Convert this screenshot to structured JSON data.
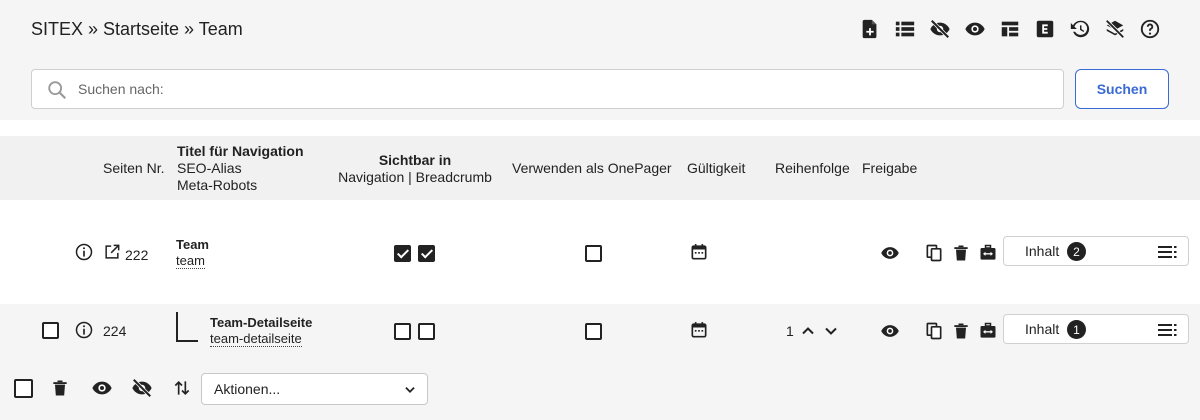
{
  "breadcrumb": "SITEX » Startseite » Team",
  "toolbar": {
    "icons": [
      "new-page-icon",
      "list-icon",
      "eye-slash-icon",
      "eye-icon",
      "layout-icon",
      "elementor-icon",
      "history-icon",
      "layers-slash-icon",
      "help-icon"
    ]
  },
  "search": {
    "placeholder": "Suchen nach:",
    "button_label": "Suchen"
  },
  "table": {
    "headers": {
      "page_nr": "Seiten Nr.",
      "title_line1": "Titel für Navigation",
      "title_line2": "SEO-Alias",
      "title_line3": "Meta-Robots",
      "visible_line1": "Sichtbar in",
      "visible_line2": "Navigation | Breadcrumb",
      "onepager": "Verwenden als OnePager",
      "validity": "Gültigkeit",
      "order": "Reihenfolge",
      "release": "Freigabe"
    },
    "rows": [
      {
        "page_nr": "222",
        "title": "Team",
        "alias": "team",
        "nav_visible": true,
        "breadcrumb_visible": true,
        "onepager": false,
        "order": "",
        "content_label": "Inhalt",
        "content_count": "2"
      },
      {
        "page_nr": "224",
        "title": "Team-Detailseite",
        "alias": "team-detailseite",
        "nav_visible": false,
        "breadcrumb_visible": false,
        "onepager": false,
        "order": "1",
        "content_label": "Inhalt",
        "content_count": "1",
        "warning": true
      }
    ]
  },
  "bulk": {
    "actions_label": "Aktionen..."
  },
  "colors": {
    "accent": "#3a6ad4",
    "warning": "#d9a520"
  }
}
